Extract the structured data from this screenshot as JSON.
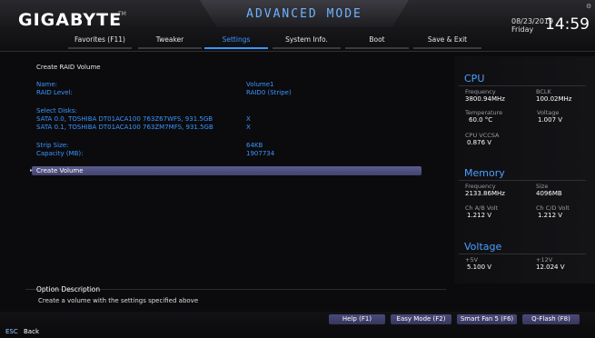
{
  "header": {
    "brand": "GIGABYTE",
    "brand_tm": "TM",
    "mode": "ADVANCED MODE",
    "date": "08/23/2019",
    "day": "Friday",
    "time": "14:59"
  },
  "tabs": [
    {
      "label": "Favorites (F11)"
    },
    {
      "label": "Tweaker"
    },
    {
      "label": "Settings"
    },
    {
      "label": "System Info."
    },
    {
      "label": "Boot"
    },
    {
      "label": "Save & Exit"
    }
  ],
  "active_tab": "Settings",
  "main": {
    "title": "Create RAID Volume",
    "name_label": "Name:",
    "name_value": "Volume1",
    "raid_level_label": "RAID Level:",
    "raid_level_value": "RAID0 (Stripe)",
    "select_disks_label": "Select Disks:",
    "disks": [
      {
        "label": "SATA 0.0, TOSHIBA DT01ACA100 763Z67WFS, 931.5GB",
        "value": "X"
      },
      {
        "label": "SATA 0.1, TOSHIBA DT01ACA100 763ZM7MFS, 931.5GB",
        "value": "X"
      }
    ],
    "strip_size_label": "Strip Size:",
    "strip_size_value": "64KB",
    "capacity_label": "Capacity (MB):",
    "capacity_value": "1907734",
    "create_volume_label": "Create Volume"
  },
  "description": {
    "title": "Option Description",
    "text": "Create a volume with the settings specified above"
  },
  "side": {
    "cpu": {
      "title": "CPU",
      "frequency_label": "Frequency",
      "frequency_value": "3800.94MHz",
      "bclk_label": "BCLK",
      "bclk_value": "100.02MHz",
      "temperature_label": "Temperature",
      "temperature_value": "60.0 °C",
      "voltage_label": "Voltage",
      "voltage_value": "1.007 V",
      "vccsa_label": "CPU VCCSA",
      "vccsa_value": "0.876 V"
    },
    "memory": {
      "title": "Memory",
      "frequency_label": "Frequency",
      "frequency_value": "2133.86MHz",
      "size_label": "Size",
      "size_value": "4096MB",
      "chab_label": "Ch A/B Volt",
      "chab_value": "1.212 V",
      "chcd_label": "Ch C/D Volt",
      "chcd_value": "1.212 V"
    },
    "voltage": {
      "title": "Voltage",
      "p5_label": "+5V",
      "p5_value": "5.100 V",
      "p12_label": "+12V",
      "p12_value": "12.024 V"
    }
  },
  "footer": {
    "help": "Help (F1)",
    "easy": "Easy Mode (F2)",
    "smartfan": "Smart Fan 5 (F6)",
    "qflash": "Q-Flash (F8)",
    "esc": "ESC",
    "back": "Back"
  },
  "colors": {
    "accent": "#3b95ff",
    "selection": "#4a4a7a",
    "background": "#0b0b0d"
  }
}
